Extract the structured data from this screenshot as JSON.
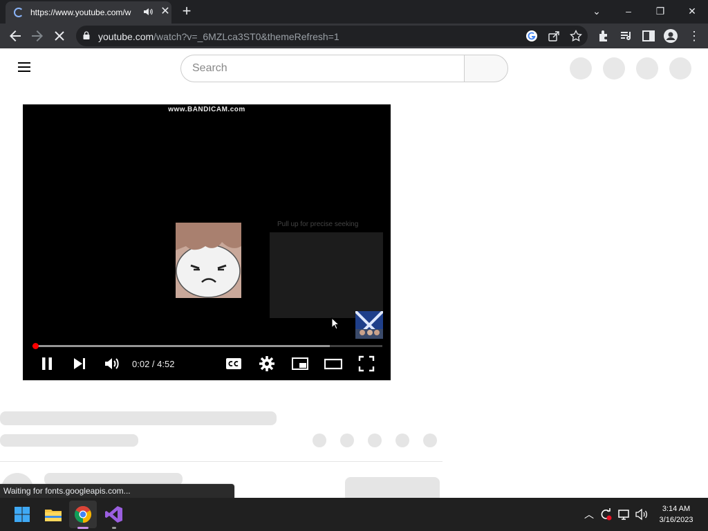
{
  "browser": {
    "tab_title": "https://www.youtube.com/w",
    "url_host": "youtube.com",
    "url_path": "/watch?v=_6MZLca3ST0&themeRefresh=1",
    "new_tab_label": "+"
  },
  "youtube": {
    "search_placeholder": "Search"
  },
  "player": {
    "watermark": "www.BANDICAM.com",
    "side_caption": "Pull up for precise seeking",
    "current_time": "0:02",
    "duration": "4:52",
    "time_display": "0:02 / 4:52",
    "progress_fraction": 0.007,
    "buffered_fraction": 0.85
  },
  "status_bar": {
    "text": "Waiting for fonts.googleapis.com..."
  },
  "taskbar": {
    "time": "3:14 AM",
    "date": "3/16/2023"
  },
  "colors": {
    "accent_red": "#ff0000",
    "chrome_dark": "#202124",
    "chrome_toolbar": "#35363a",
    "skeleton": "#e5e5e5"
  }
}
